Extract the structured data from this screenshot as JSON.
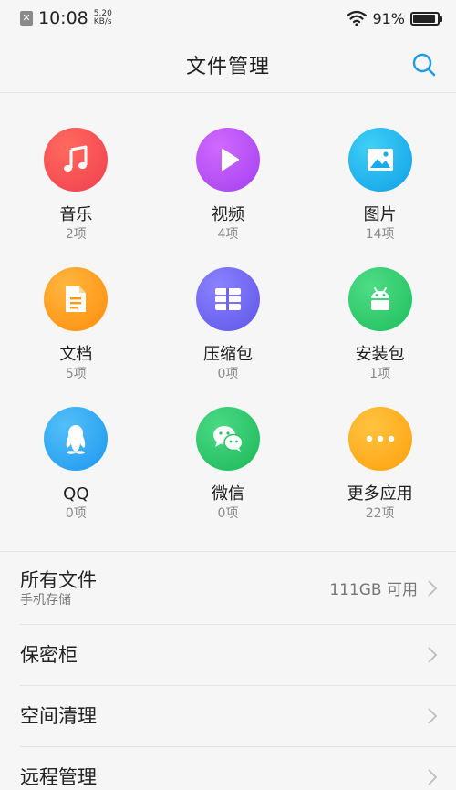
{
  "status_bar": {
    "time": "10:08",
    "speed_value": "5.20",
    "speed_unit": "KB/s",
    "battery_text": "91%",
    "battery_level": 0.91
  },
  "header": {
    "title": "文件管理"
  },
  "categories": [
    {
      "name": "音乐",
      "count": "2项",
      "icon": "music-icon",
      "color": "#f7484f"
    },
    {
      "name": "视频",
      "count": "4项",
      "icon": "play-icon",
      "color": "#b74bf3"
    },
    {
      "name": "图片",
      "count": "14项",
      "icon": "image-icon",
      "color": "#1fb3ee"
    },
    {
      "name": "文档",
      "count": "5项",
      "icon": "document-icon",
      "color": "#ff9a12"
    },
    {
      "name": "压缩包",
      "count": "0项",
      "icon": "archive-icon",
      "color": "#6f65f2"
    },
    {
      "name": "安装包",
      "count": "1项",
      "icon": "android-icon",
      "color": "#27c868"
    },
    {
      "name": "QQ",
      "count": "0项",
      "icon": "penguin-icon",
      "color": "#2aa5f2"
    },
    {
      "name": "微信",
      "count": "0项",
      "icon": "wechat-icon",
      "color": "#27c462"
    },
    {
      "name": "更多应用",
      "count": "22项",
      "icon": "more-dots-icon",
      "color": "#ffac16"
    }
  ],
  "list": {
    "all_files": {
      "title": "所有文件",
      "subtitle": "手机存储",
      "value": "111GB 可用"
    },
    "safe_box": {
      "title": "保密柜"
    },
    "space_clean": {
      "title": "空间清理"
    },
    "remote_manage": {
      "title": "远程管理"
    }
  }
}
